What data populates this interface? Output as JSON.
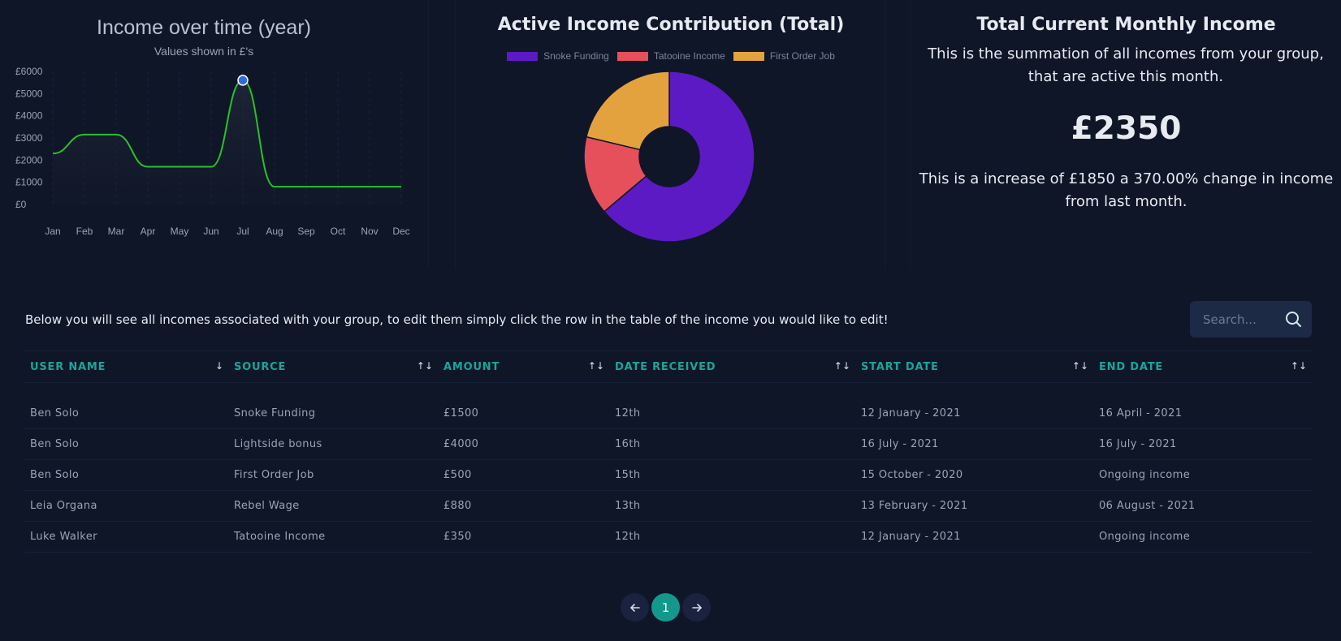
{
  "line_chart": {
    "title": "Income over time (year)",
    "subtitle": "Values shown in £'s",
    "line_color": "#27c22a",
    "highlight_color": "#2d6de0",
    "chart_data": {
      "type": "line",
      "categories": [
        "Jan",
        "Feb",
        "Mar",
        "Apr",
        "May",
        "Jun",
        "Jul",
        "Aug",
        "Sep",
        "Oct",
        "Nov",
        "Dec"
      ],
      "values": [
        2300,
        3150,
        3150,
        1700,
        1700,
        1700,
        5600,
        800,
        800,
        800,
        800,
        800
      ],
      "y_ticks": [
        "£6000",
        "£5000",
        "£4000",
        "£3000",
        "£2000",
        "£1000",
        "£0"
      ],
      "ylim": [
        0,
        6000
      ],
      "highlighted_point": "Jul"
    }
  },
  "donut_chart": {
    "title": "Active Income Contribution (Total)",
    "chart_data": {
      "type": "pie",
      "series": [
        {
          "name": "Snoke Funding",
          "value": 1500,
          "color": "#5c1ac5"
        },
        {
          "name": "Tatooine Income",
          "value": 350,
          "color": "#e5505a"
        },
        {
          "name": "First Order Job",
          "value": 500,
          "color": "#e3a23e"
        }
      ]
    }
  },
  "total": {
    "title": "Total Current Monthly Income",
    "description": "This is the summation of all incomes from your group, that are active this month.",
    "amount": "£2350",
    "change_text": "This is a increase of £1850 a 370.00% change in income from last month."
  },
  "table_section": {
    "intro": "Below you will see all incomes associated with your group, to edit them simply click the row in the table of the income you would like to edit!",
    "search_placeholder": "Search...",
    "columns": [
      "User Name",
      "Source",
      "Amount",
      "Date Received",
      "Start Date",
      "End Date"
    ],
    "sort_icons": [
      "↓",
      "↑↓",
      "↑↓",
      "↑↓",
      "↑↓",
      "↑↓"
    ],
    "rows": [
      [
        "Ben Solo",
        "Snoke Funding",
        "£1500",
        "12th",
        "12 January - 2021",
        "16 April - 2021"
      ],
      [
        "Ben Solo",
        "Lightside bonus",
        "£4000",
        "16th",
        "16 July - 2021",
        "16 July - 2021"
      ],
      [
        "Ben Solo",
        "First Order Job",
        "£500",
        "15th",
        "15 October - 2020",
        "Ongoing income"
      ],
      [
        "Leia Organa",
        "Rebel Wage",
        "£880",
        "13th",
        "13 February - 2021",
        "06 August - 2021"
      ],
      [
        "Luke Walker",
        "Tatooine Income",
        "£350",
        "12th",
        "12 January - 2021",
        "Ongoing income"
      ]
    ]
  },
  "pagination": {
    "prev_icon": "arrow-left-icon",
    "current_page": "1",
    "next_icon": "arrow-right-icon"
  }
}
